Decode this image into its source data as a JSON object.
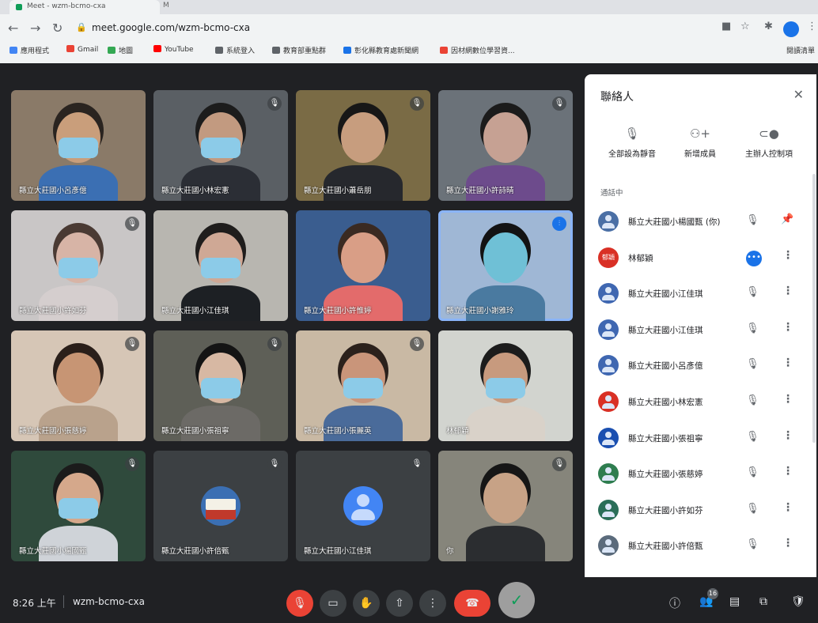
{
  "browser": {
    "tab_title": "Meet - wzm-bcmo-cxa",
    "tab2_title": "M",
    "url": "meet.google.com/wzm-bcmo-cxa",
    "profile_initial": "",
    "bookmarks": [
      {
        "label": "應用程式",
        "color": "#4285f4"
      },
      {
        "label": "Gmail",
        "color": "#ea4335"
      },
      {
        "label": "地圖",
        "color": "#34a853"
      },
      {
        "label": "YouTube",
        "color": "#ff0000"
      },
      {
        "label": "系統登入",
        "color": "#5f6368"
      },
      {
        "label": "教育部重點群",
        "color": "#5f6368"
      },
      {
        "label": "彰化縣教育處新聞網",
        "color": "#1a73e8"
      },
      {
        "label": "因材網數位學習資...",
        "color": "#ea4335"
      }
    ],
    "reading_list": "閱讀清單"
  },
  "tiles": [
    {
      "name": "縣立大莊國小呂彥億",
      "bg": "#8a7a68",
      "skin": "#c99e7b",
      "shirt": "#3b6fb3",
      "mask": true,
      "hair": "#2a2420",
      "muted": false
    },
    {
      "name": "縣立大莊國小林宏憲",
      "bg": "#5a5f64",
      "skin": "#c29a80",
      "shirt": "#2b2e35",
      "mask": true,
      "hair": "#1c1c1c",
      "muted": true
    },
    {
      "name": "縣立大莊國小蕭岳朋",
      "bg": "#7a6b45",
      "skin": "#c79d7e",
      "shirt": "#26282d",
      "mask": false,
      "hair": "#171717",
      "muted": true
    },
    {
      "name": "縣立大莊國小許詩晴",
      "bg": "#6b7279",
      "skin": "#c6a193",
      "shirt": "#6d4b8c",
      "mask": false,
      "hair": "#1b1b1b",
      "muted": true
    },
    {
      "name": "縣立大莊國小許如芬",
      "bg": "#c9c6c6",
      "skin": "#d7b4a6",
      "shirt": "#d5cece",
      "mask": true,
      "hair": "#4a3a33",
      "muted": true
    },
    {
      "name": "縣立大莊國小江佳琪",
      "bg": "#b8b6b0",
      "skin": "#cfa895",
      "shirt": "#1d2024",
      "mask": true,
      "hair": "#1f1d1c",
      "muted": false
    },
    {
      "name": "縣立大莊國小許惟婷",
      "bg": "#3a5d8f",
      "skin": "#d99e86",
      "shirt": "#e36b6b",
      "mask": false,
      "hair": "#3a2a22",
      "muted": false
    },
    {
      "name": "縣立大莊國小謝雅玲",
      "bg": "#9fb7d5",
      "skin": "#6fc0d6",
      "shirt": "#4a7aa0",
      "mask": false,
      "hair": "#131313",
      "muted": false,
      "active": true
    },
    {
      "name": "縣立大莊國小張慈婷",
      "bg": "#d6c6b6",
      "skin": "#c79574",
      "shirt": "#b9a28c",
      "mask": false,
      "hair": "#2a1f1a",
      "muted": true
    },
    {
      "name": "縣立大莊國小張祖寧",
      "bg": "#5e5f57",
      "skin": "#d7b8a3",
      "shirt": "#6c6a66",
      "mask": true,
      "hair": "#141414",
      "muted": true
    },
    {
      "name": "縣立大莊國小張麗英",
      "bg": "#c9b9a4",
      "skin": "#c9957a",
      "shirt": "#4a6b9a",
      "mask": true,
      "hair": "#2b211c",
      "muted": true
    },
    {
      "name": "林郁穎",
      "bg": "#d2d4cf",
      "skin": "#c79a7e",
      "shirt": "#d9d2c9",
      "mask": true,
      "hair": "#1c1c1c",
      "muted": false
    },
    {
      "name": "縣立大莊國小楊國甄",
      "bg": "#2f4a3c",
      "skin": "#d5a88b",
      "shirt": "#cfd3d8",
      "mask": true,
      "hair": "#1b1b1b",
      "muted": true
    },
    {
      "name": "縣立大莊國小許倍甄",
      "bg": "#3c4043",
      "avatar": "photo",
      "muted": true
    },
    {
      "name": "縣立大莊國小江佳琪",
      "bg": "#3c4043",
      "avatar": "default",
      "muted": true
    },
    {
      "name": "你",
      "bg": "#86857b",
      "skin": "#c7a286",
      "shirt": "#2b2d30",
      "mask": false,
      "hair": "#161616",
      "muted": true
    }
  ],
  "bottom": {
    "time": "8:26 上午",
    "meeting_code": "wzm-bcmo-cxa",
    "people_count": "16"
  },
  "panel": {
    "title": "聯絡人",
    "actions": [
      {
        "label": "全部設為靜音",
        "icon": "mute-all-icon",
        "glyph": "🎙"
      },
      {
        "label": "新增成員",
        "icon": "add-person-icon",
        "glyph": "⚇+"
      },
      {
        "label": "主辦人控制項",
        "icon": "host-controls-icon",
        "glyph": "⊂●"
      }
    ],
    "section": "通話中",
    "people": [
      {
        "name": "縣立大莊國小楊國甄 (你)",
        "color": "#4a6fa5",
        "initials": "",
        "state": "pin"
      },
      {
        "name": "林郁穎",
        "color": "#d93025",
        "initials": "郁穎",
        "state": "speaking"
      },
      {
        "name": "縣立大莊國小江佳琪",
        "color": "#3f67b1",
        "initials": "",
        "state": "muted"
      },
      {
        "name": "縣立大莊國小江佳琪",
        "color": "#3f67b1",
        "initials": "",
        "state": "muted"
      },
      {
        "name": "縣立大莊國小呂彥億",
        "color": "#3f67b1",
        "initials": "",
        "state": "muted"
      },
      {
        "name": "縣立大莊國小林宏憲",
        "color": "#d93025",
        "initials": "",
        "state": "muted"
      },
      {
        "name": "縣立大莊國小張祖寧",
        "color": "#1a4fb0",
        "initials": "",
        "state": "muted"
      },
      {
        "name": "縣立大莊國小張慈婷",
        "color": "#2e7d4f",
        "initials": "",
        "state": "muted"
      },
      {
        "name": "縣立大莊國小許如芬",
        "color": "#2a6e58",
        "initials": "",
        "state": "muted"
      },
      {
        "name": "縣立大莊國小許倍甄",
        "color": "#5b6b7c",
        "initials": "",
        "state": "muted"
      }
    ]
  }
}
